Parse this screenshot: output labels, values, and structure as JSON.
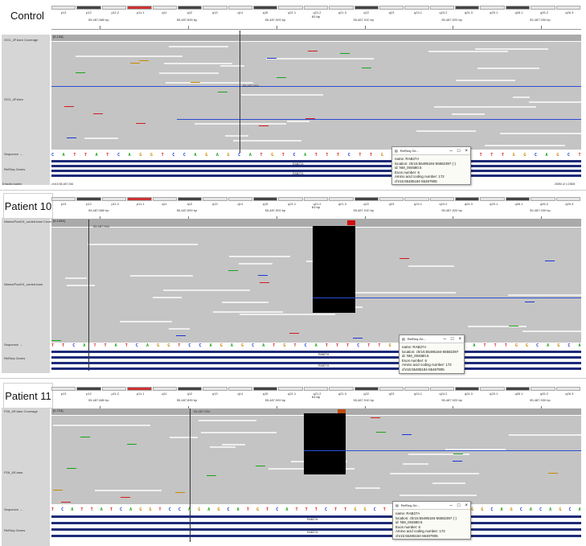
{
  "panels": [
    {
      "title": "Control",
      "boxed": false,
      "ideogram": [
        "p13",
        "p12",
        "p11.2",
        "p11.1",
        "q11",
        "q12",
        "q13",
        "q14",
        "q15",
        "q21.1",
        "q21.2",
        "q21.3",
        "q22",
        "q23",
        "q24.1",
        "q24.2",
        "q24.3",
        "q25.1",
        "q26.1",
        "q26.2",
        "q26.3"
      ],
      "size": "61 bp",
      "ticks": [
        "55,487,880 bp",
        "55,487,890 bp",
        "55,487,900 bp",
        "55,487,910 bp",
        "55,487,920 bp",
        "55,487,930 bp"
      ],
      "coverage_label": "GG1_4F.bam Coverage",
      "range": "[0-134]",
      "reads_label": "GG1_4F.bam",
      "center_label": "55,487,904",
      "sequence_label": "Sequence →",
      "genes_label": "RefSeq Genes",
      "sequence": "CATTATCAGGTCCAGAGCATGTCATTTCTTGGCTTAGAATTTGGCAGCT",
      "gene": "RAB27A",
      "popup": {
        "title": "RefSeq Ge...",
        "name": "name: RAB27A",
        "location": "location: chr15:55495184-55582397 (-)",
        "id": "id: NM_004580.5",
        "exon": "Exon number: 6",
        "aa": "Amino acid coding number: 172",
        "coords": "chr15:55485184-55487905"
      },
      "status_left": "6 tracks loaded",
      "status_mid": "chr15:55,487,946",
      "status_right": "265M of 1,035M"
    },
    {
      "title": "Patient 10",
      "boxed": true,
      "ideogram": [
        "p13",
        "p12",
        "p11.2",
        "p11.1",
        "q11",
        "q12",
        "q13",
        "q14",
        "q15",
        "q21.1",
        "q21.2",
        "q21.3",
        "q22",
        "q23",
        "q24.1",
        "q24.2",
        "q24.3",
        "q25.1",
        "q26.1",
        "q26.2",
        "q26.3"
      ],
      "size": "61 bp",
      "ticks": [
        "55,487,880 bp",
        "55,487,890 bp",
        "55,487,900 bp",
        "55,487,910 bp",
        "55,487,920 bp",
        "55,487,930 bp"
      ],
      "coverage_label": "Nimes/Pcs001_sorted.bam Cover",
      "range": "[0-1054]",
      "reads_label": "Nimes/Pcs001_sorted.bam",
      "center_label": "55,487,904",
      "sequence_label": "Sequence →",
      "genes_label": "RefSeq Genes",
      "sequence": "TTCATTATCAGGTCCAGAGCATGTCATTTCTTGGCTTAGAATTTGGCAGCA",
      "gene": "RAB27A",
      "popup": {
        "title": "RefSeq Ge...",
        "name": "name: RAB27A",
        "location": "location: chr15:55495184-55582397",
        "id": "id: NM_004580.5",
        "exon": "Exon number: 6",
        "aa": "Amino acid coding number: 172",
        "coords": "chr15:55485184-55487905"
      },
      "status_left": "",
      "status_mid": "",
      "status_right": ""
    },
    {
      "title": "Patient 11",
      "boxed": true,
      "ideogram": [
        "p13",
        "p12",
        "p11.2",
        "p11.1",
        "q11",
        "q12",
        "q13",
        "q14",
        "q15",
        "q21.1",
        "q21.2",
        "q21.3",
        "q22",
        "q23",
        "q24.1",
        "q24.2",
        "q24.3",
        "q25.1",
        "q26.1",
        "q26.2",
        "q26.3"
      ],
      "size": "61 bp",
      "ticks": [
        "55,487,880 bp",
        "55,487,890 bp",
        "55,487,900 bp",
        "55,487,910 bp",
        "55,487,920 bp",
        "55,487,930 bp"
      ],
      "coverage_label": "P26_4R.bam Coverage",
      "range": "[0-724]",
      "reads_label": "P26_4R.bam",
      "center_label": "55,487,904",
      "sequence_label": "Sequence →",
      "genes_label": "RefSeq Genes",
      "sequence": "TCATTATCAGGTCCAGAGCATGTCATTTCTTGGCTTAGAATTTGGCAGCACAGCA",
      "gene": "RAB27A",
      "popup": {
        "title": "RefSeq Ge...",
        "name": "name: RAB27A",
        "location": "location: chr15:55495184-55582397 (-)",
        "id": "id: NM_004580.5",
        "exon": "Exon number: 6",
        "aa": "Amino acid coding number: 172",
        "coords": "chr15:55485184-55487905"
      },
      "status_left": "",
      "status_mid": "",
      "status_right": ""
    }
  ],
  "colors": {
    "coverage": "#aaaaaa",
    "reads": "#c4c4c4",
    "gene": "#1e2b78",
    "deletion": "#000000",
    "insertion": "#2a4fd4"
  },
  "base_colors": {
    "A": "#1aa31a",
    "C": "#1a35d6",
    "G": "#c98a00",
    "T": "#d61a1a"
  }
}
